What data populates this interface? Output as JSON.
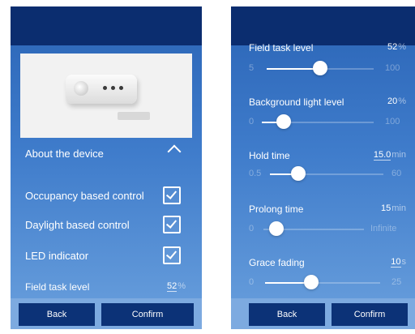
{
  "left": {
    "section_title": "About the device",
    "options": [
      {
        "label": "Occupancy based control",
        "checked": true
      },
      {
        "label": "Daylight based control",
        "checked": true
      },
      {
        "label": "LED indicator",
        "checked": true
      }
    ],
    "field_task": {
      "label": "Field task level",
      "value": "52",
      "unit": "%"
    },
    "buttons": {
      "back": "Back",
      "confirm": "Confirm"
    }
  },
  "right": {
    "sliders": [
      {
        "label": "Field task level",
        "value": "52",
        "unit": "%",
        "min": "5",
        "max": "100",
        "level": 0.52
      },
      {
        "label": "Background light level",
        "value": "20",
        "unit": "%",
        "min": "0",
        "max": "100",
        "level": 0.2
      },
      {
        "label": "Hold time",
        "value": "15.0",
        "unit": "min",
        "min": "0.5",
        "max": "60",
        "level": 0.24
      },
      {
        "label": "Prolong time",
        "value": "15",
        "unit": "min",
        "min": "0",
        "max": "Infinite",
        "level": 0.0
      },
      {
        "label": "Grace fading",
        "value": "10",
        "unit": "s",
        "min": "0",
        "max": "25",
        "level": 0.4
      }
    ],
    "buttons": {
      "back": "Back",
      "confirm": "Confirm"
    }
  },
  "colors": {
    "header": "#0b2d6f",
    "button": "#0c3277",
    "footer": "#7daae0",
    "accent": "#ffffff"
  }
}
